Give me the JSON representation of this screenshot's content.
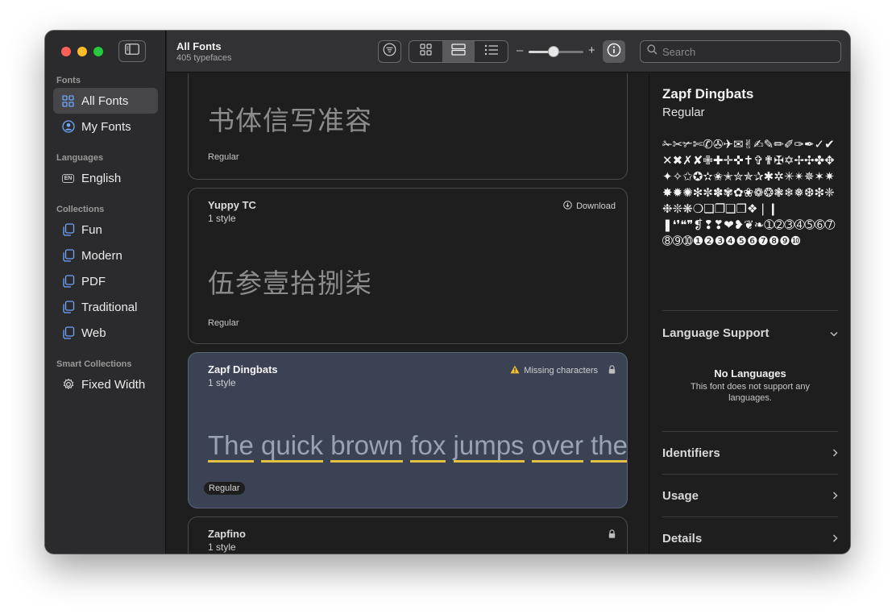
{
  "sidebar": {
    "fonts_header": "Fonts",
    "fonts_items": [
      {
        "label": "All Fonts",
        "icon": "grid-icon",
        "active": true
      },
      {
        "label": "My Fonts",
        "icon": "person-circle-icon",
        "active": false
      }
    ],
    "languages_header": "Languages",
    "language_items": [
      {
        "label": "English",
        "icon": "en-badge-icon",
        "badge": "EN"
      }
    ],
    "collections_header": "Collections",
    "collection_items": [
      {
        "label": "Fun",
        "icon": "collection-icon"
      },
      {
        "label": "Modern",
        "icon": "collection-icon"
      },
      {
        "label": "PDF",
        "icon": "collection-icon"
      },
      {
        "label": "Traditional",
        "icon": "collection-icon"
      },
      {
        "label": "Web",
        "icon": "collection-icon"
      }
    ],
    "smart_header": "Smart Collections",
    "smart_items": [
      {
        "label": "Fixed Width",
        "icon": "gear-icon"
      }
    ]
  },
  "toolbar": {
    "title": "All Fonts",
    "subtitle": "405 typefaces",
    "zoom_minus": "–",
    "zoom_plus": "+",
    "zoom_level": 0.45,
    "view_mode": "strips",
    "search_placeholder": "Search",
    "search_value": ""
  },
  "list": {
    "cards": [
      {
        "name": "",
        "styles": "",
        "preview": "书体信写准容",
        "style_tag": "Regular",
        "action": ""
      },
      {
        "name": "Yuppy TC",
        "styles": "1 style",
        "preview": "伍参壹拾捌柒",
        "style_tag": "Regular",
        "action": "Download"
      },
      {
        "name": "Zapf Dingbats",
        "styles": "1 style",
        "preview_words": [
          "The",
          "quick",
          "brown",
          "fox",
          "jumps",
          "over",
          "the"
        ],
        "style_tag": "Regular",
        "action": "Missing characters"
      },
      {
        "name": "Zapfino",
        "styles": "1 style"
      }
    ]
  },
  "panel": {
    "font_name": "Zapf Dingbats",
    "style": "Regular",
    "glyph_sample": "✁✂✃✄✆✇✈✉✌✍✎✏✐✑✒✓✔✕✖✗✘✙✚✛✜✝✞✟✠✡✢✣✤✥✦✧✩✪✫✬✭✮✯✰✱✲✳✴✵✶✷✸✹✺✻✼✽✾✿❀❁❂❃❄❅❆❇❈❉❊❋❍❏❐❑❒❖❘❙❚❛❜❝❞❡❢❣❤❥❦❧➀➁➂➃➄➅➆➇➈➉❶❷❸❹❺❻❼❽❾❿",
    "language_support_label": "Language Support",
    "no_languages_title": "No Languages",
    "no_languages_desc": "This font does not support any languages.",
    "identifiers_label": "Identifiers",
    "usage_label": "Usage",
    "details_label": "Details"
  },
  "colors": {
    "accent_selected_card": "#3a4253",
    "warning": "#f2c230",
    "underline": "#e2c042"
  }
}
